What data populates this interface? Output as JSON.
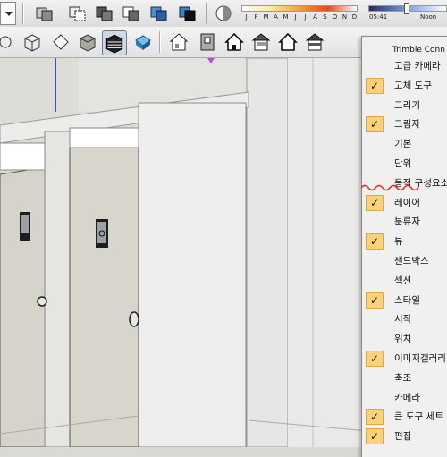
{
  "toolbar": {
    "dropdown_icon": "chevron-down-icon",
    "row1_buttons": [
      "hidden-geometry-icon",
      "xray-icon",
      "back-edges-icon",
      "shaded-icon",
      "shaded-textures-icon",
      "monochrome-icon"
    ],
    "row2_buttons": [
      "wireframe-style-icon",
      "hidden-line-style-icon",
      "shaded-style-icon",
      "shaded-textures-style-icon",
      "monochrome-style-icon",
      "iso-view-icon",
      "top-view-icon",
      "front-view-icon",
      "right-view-icon",
      "back-view-icon",
      "left-view-icon"
    ],
    "active_style": "shaded-textures-style-icon"
  },
  "shadows": {
    "icon": "shadows-toggle-icon",
    "months": [
      "J",
      "F",
      "M",
      "A",
      "M",
      "J",
      "J",
      "A",
      "S",
      "O",
      "N",
      "D"
    ],
    "time_start": "05:41",
    "time_end": "Noon"
  },
  "menu": {
    "items": [
      {
        "label": "Trimble Conn",
        "checked": false
      },
      {
        "label": "고급 카메라",
        "checked": false
      },
      {
        "label": "고체 도구",
        "checked": true
      },
      {
        "label": "그리기",
        "checked": false
      },
      {
        "label": "그림자",
        "checked": true
      },
      {
        "label": "기본",
        "checked": false
      },
      {
        "label": "단위",
        "checked": false
      },
      {
        "label": "동적 구성요소",
        "checked": false
      },
      {
        "label": "레이어",
        "checked": true
      },
      {
        "label": "분류자",
        "checked": false
      },
      {
        "label": "뷰",
        "checked": true
      },
      {
        "label": "샌드박스",
        "checked": false
      },
      {
        "label": "섹션",
        "checked": false
      },
      {
        "label": "스타일",
        "checked": true
      },
      {
        "label": "시작",
        "checked": false
      },
      {
        "label": "위치",
        "checked": false
      },
      {
        "label": "이미지갤러리",
        "checked": true
      },
      {
        "label": "축조",
        "checked": false
      },
      {
        "label": "카메라",
        "checked": false
      },
      {
        "label": "큰 도구 세트",
        "checked": true
      },
      {
        "label": "편집",
        "checked": true
      }
    ],
    "check_glyph": "✓",
    "highlight": "#ffd27a"
  },
  "scene": {
    "content": "restroom-stall-partitions-3d-model",
    "door_sign_icons": [
      "door-sign-icon",
      "wheelchair-sign-icon"
    ]
  }
}
